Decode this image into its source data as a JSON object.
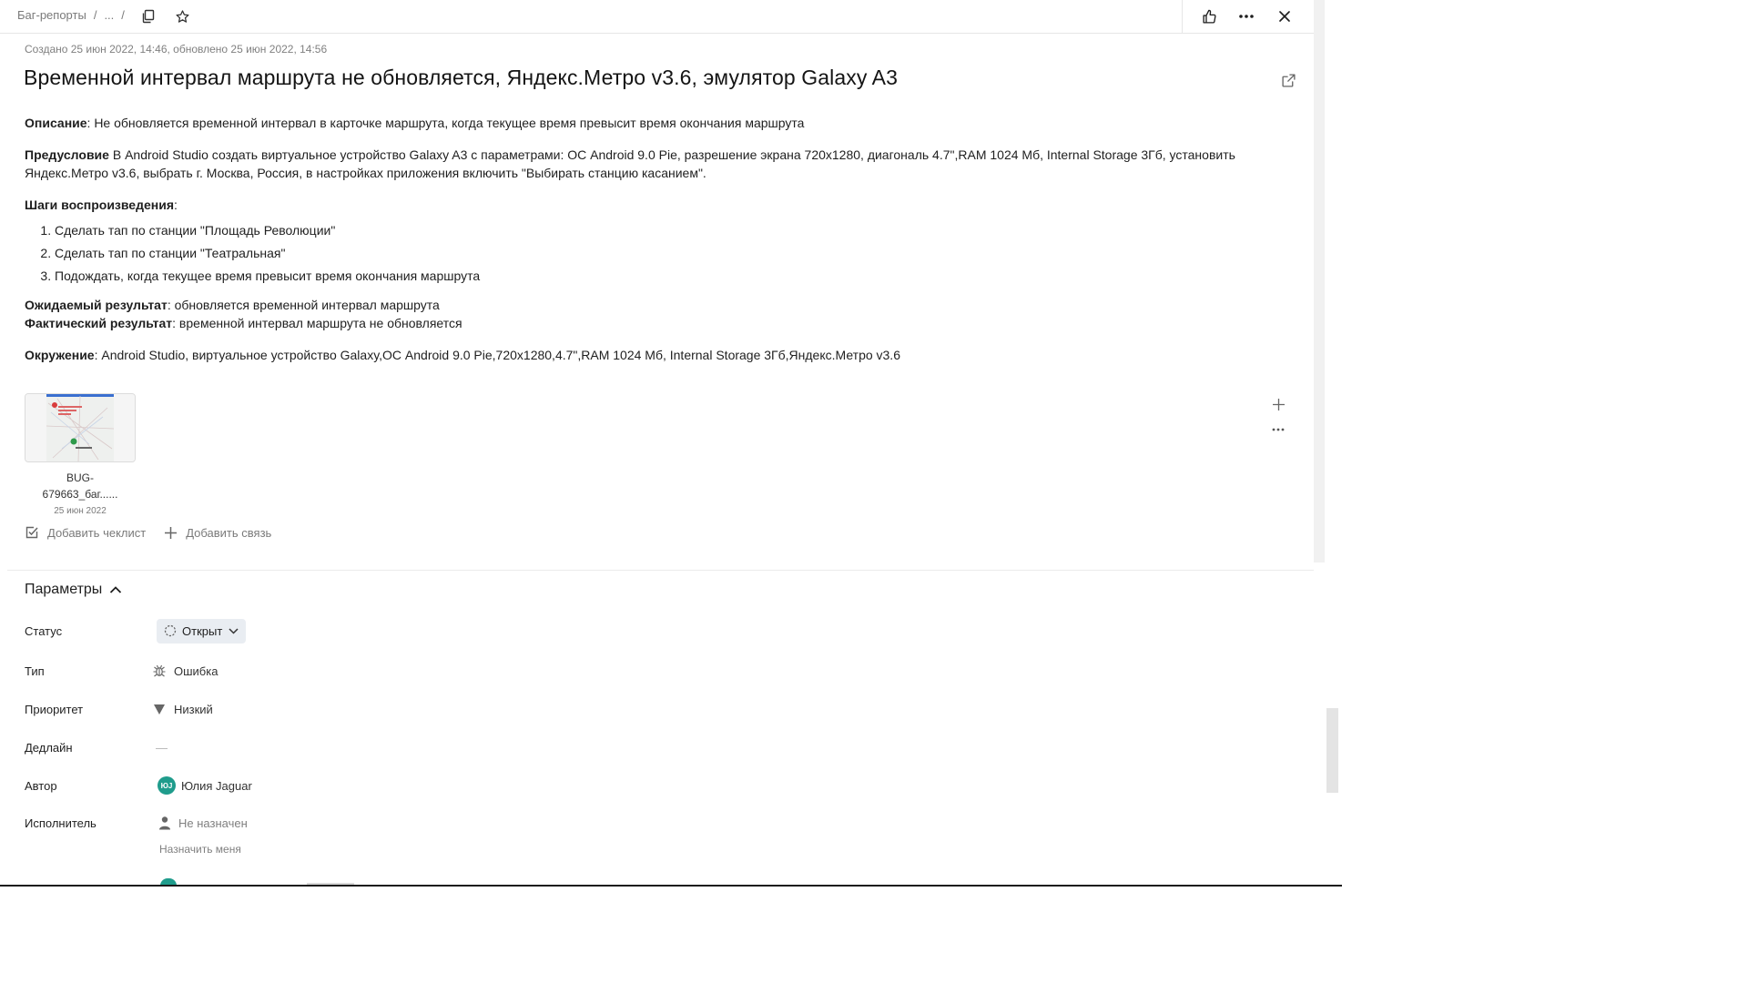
{
  "breadcrumb": {
    "root": "Баг-репорты",
    "sep1": "/",
    "ellipsis": "...",
    "sep2": "/"
  },
  "meta": "Создано 25 июн 2022, 14:46, обновлено 25 июн 2022, 14:56",
  "title": "Временной интервал маршрута не обновляется, Яндекс.Метро v3.6, эмулятор Galaxy A3",
  "description": {
    "desc_label": "Описание",
    "desc_text": ": Не обновляется временной интервал в карточке маршрута, когда текущее время превысит время окончания маршрута",
    "pre_label": "Предусловие",
    "pre_text": " В Android Studio создать виртуальное устройство Galaxy A3 с параметрами: ОС Android 9.0 Pie, разрешение экрана 720x1280, диагональ 4.7\",RAM 1024 Мб, Internal Storage 3Гб, установить Яндекс.Метро v3.6, выбрать г. Москва, Россия, в настройках приложения включить \"Выбирать станцию касанием\".",
    "steps_label": "Шаги воспроизведения",
    "steps_colon": ":",
    "steps": [
      "Сделать тап по станции \"Площадь Революции\"",
      "Сделать тап по станции \"Театральная\"",
      "Подождать, когда текущее время превысит время окончания маршрута"
    ],
    "expected_label": "Ожидаемый результат",
    "expected_text": ": обновляется временной интервал маршрута",
    "actual_label": "Фактический результат",
    "actual_text": ": временной интервал маршрута не обновляется",
    "env_label": "Окружение",
    "env_text": ": Android Studio, виртуальное устройство Galaxy,ОС Android 9.0 Pie,720x1280,4.7\",RAM 1024 Мб, Internal Storage 3Гб,Яндекс.Метро v3.6"
  },
  "attachment": {
    "name_line1": "BUG-",
    "name_line2": "679663_баг......",
    "date": "25 июн 2022"
  },
  "actions": {
    "add_checklist": "Добавить чеклист",
    "add_link": "Добавить связь"
  },
  "params": {
    "header": "Параметры",
    "status_label": "Статус",
    "status_value": "Открыт",
    "type_label": "Тип",
    "type_value": "Ошибка",
    "priority_label": "Приоритет",
    "priority_value": "Низкий",
    "deadline_label": "Дедлайн",
    "deadline_value": "—",
    "author_label": "Автор",
    "author_initials": "ЮJ",
    "author_value": "Юлия Jaguar",
    "assignee_label": "Исполнитель",
    "assignee_value": "Не назначен",
    "assign_me": "Назначить меня"
  },
  "colors": {
    "accent_teal": "#1f9c8c",
    "status_pill_bg": "#e9edf2"
  }
}
